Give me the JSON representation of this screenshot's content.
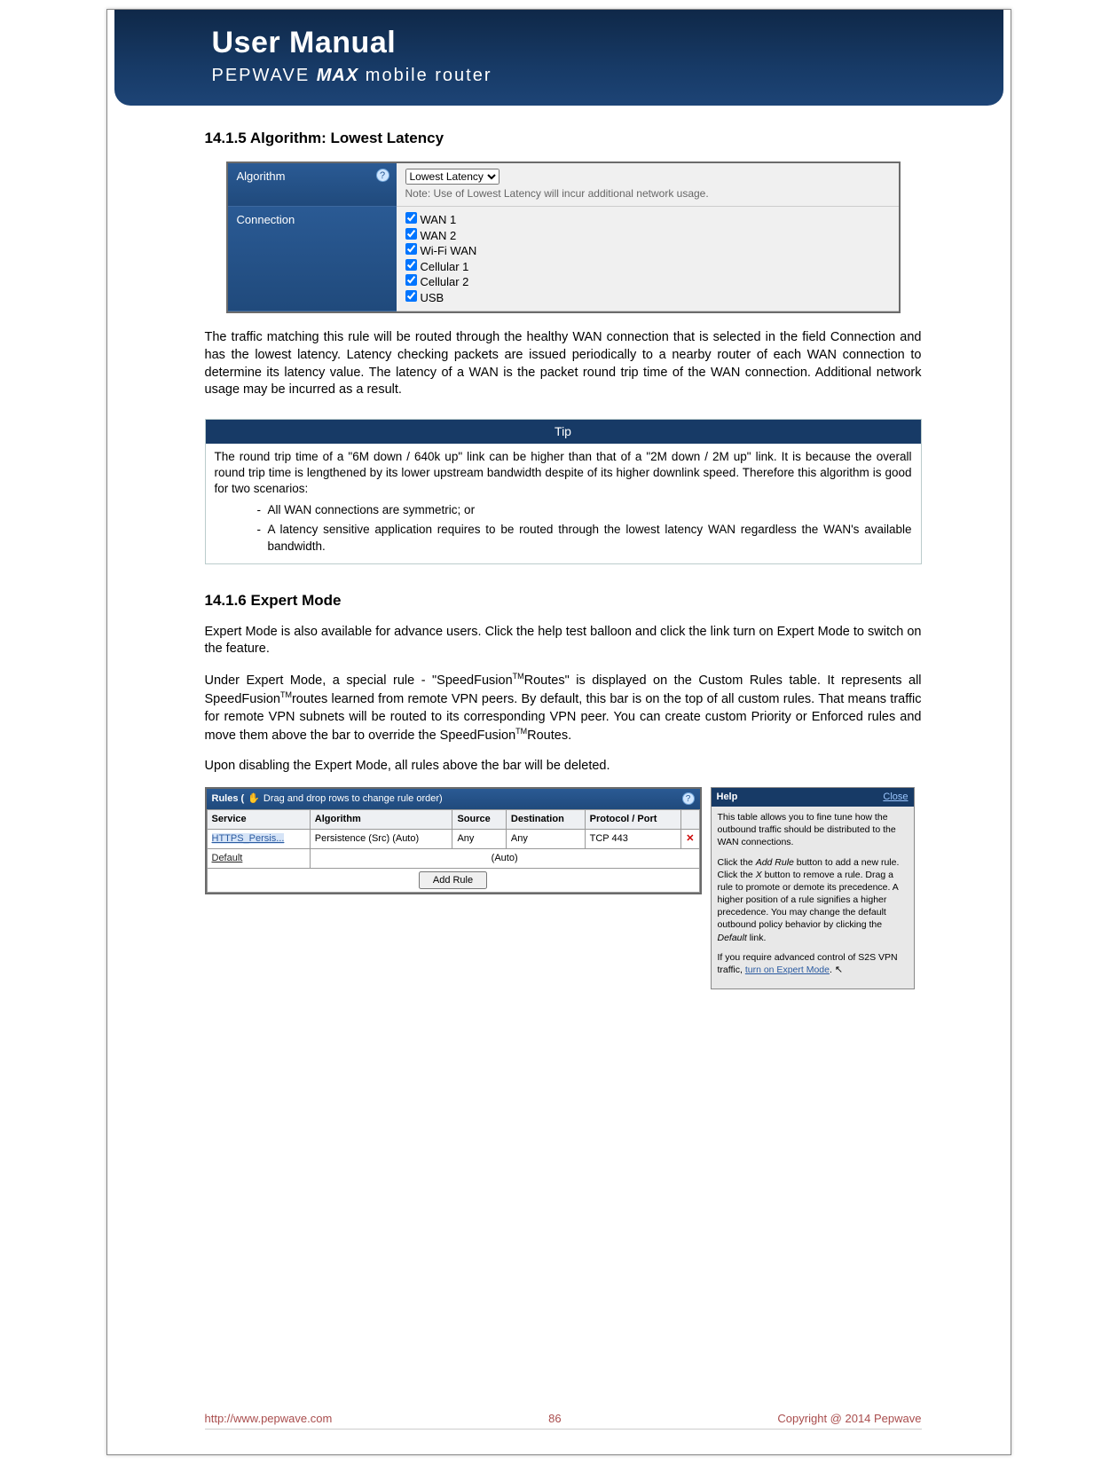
{
  "header": {
    "title": "User Manual",
    "brand_prefix": "PEPWAVE",
    "brand_bold": "MAX",
    "brand_suffix": "mobile router"
  },
  "section1": {
    "heading": "14.1.5 Algorithm: Lowest Latency",
    "algo": {
      "label_algorithm": "Algorithm",
      "dropdown_value": "Lowest Latency",
      "note": "Note: Use of Lowest Latency will incur additional network usage.",
      "label_connection": "Connection",
      "connections": [
        "WAN 1",
        "WAN 2",
        "Wi-Fi WAN",
        "Cellular 1",
        "Cellular 2",
        "USB"
      ]
    },
    "paragraph": "The traffic matching this rule will be routed through the healthy WAN connection that is selected in the field Connection and has the lowest latency. Latency checking packets are issued periodically to a nearby router of each WAN connection to determine its latency value. The latency of a WAN is the packet round trip time of the WAN connection. Additional network usage may be incurred as a result."
  },
  "tip": {
    "title": "Tip",
    "body": "The round trip time of a \"6M down / 640k up\" link can be higher than that of a \"2M down / 2M up\" link. It is because the overall round trip time is lengthened by its lower upstream bandwidth despite of its higher downlink speed. Therefore this algorithm is good for two scenarios:",
    "bullets": [
      "All WAN connections are symmetric; or",
      "A latency sensitive application requires to be routed through the lowest latency WAN regardless the WAN's available bandwidth."
    ]
  },
  "section2": {
    "heading": "14.1.6 Expert Mode",
    "p1": "Expert Mode is also available for advance users. Click the help test balloon and click the link turn on Expert Mode to switch on the feature.",
    "p2": "Under Expert Mode, a special rule - \"SpeedFusionTMRoutes\" is displayed on the Custom Rules table. It represents all SpeedFusionTMroutes learned from remote VPN peers. By default, this bar is on the top of all custom rules. That means traffic for remote VPN subnets will be routed to its corresponding VPN peer. You can create custom Priority or Enforced rules and move them above the bar to override the SpeedFusionTMRoutes.",
    "p3": "Upon disabling the Expert Mode, all rules above the bar will be deleted."
  },
  "rules": {
    "title_prefix": "Rules (",
    "title_drag": "Drag and drop rows to change rule order)",
    "headers": [
      "Service",
      "Algorithm",
      "Source",
      "Destination",
      "Protocol / Port"
    ],
    "row1": {
      "service": "HTTPS_Persis...",
      "algorithm": "Persistence (Src) (Auto)",
      "source": "Any",
      "destination": "Any",
      "protocol": "TCP 443"
    },
    "default_label": "Default",
    "default_auto": "(Auto)",
    "add_rule": "Add Rule"
  },
  "help_panel": {
    "title": "Help",
    "close": "Close",
    "p1": "This table allows you to fine tune how the outbound traffic should be distributed to the WAN connections.",
    "p2_a": "Click the ",
    "p2_add": "Add Rule",
    "p2_b": " button to add a new rule. Click the ",
    "p2_x": "X",
    "p2_c": " button to remove a rule. Drag a rule to promote or demote its precedence. A higher position of a rule signifies a higher precedence. You may change the default outbound policy behavior by clicking the ",
    "p2_def": "Default",
    "p2_d": " link.",
    "p3_a": "If you require advanced control of S2S VPN traffic, ",
    "p3_link": "turn on Expert Mode",
    "p3_b": "."
  },
  "footer": {
    "url": "http://www.pepwave.com",
    "page": "86",
    "copyright": "Copyright @ 2014 Pepwave"
  }
}
